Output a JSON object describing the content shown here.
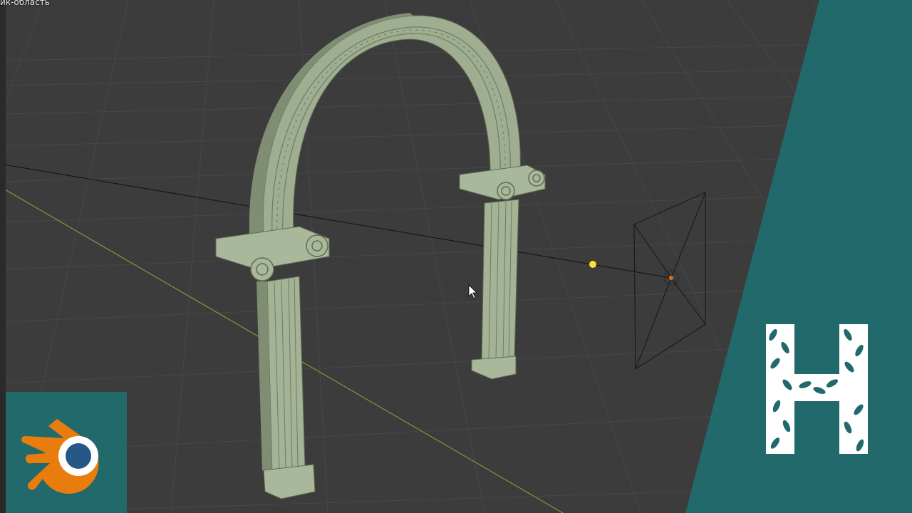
{
  "viewport": {
    "header_label": "ик-область"
  },
  "colors": {
    "viewport_bg": "#3c3c3c",
    "grid_line": "#474747",
    "axis_x": "#7a9a3a",
    "arch_stone": "#a9b89a",
    "arch_shadow": "#7f8d72",
    "teal_panel": "#22696b",
    "blender_orange": "#e87d0d",
    "blender_blue": "#265787",
    "light_yellow": "#ffe033"
  },
  "icons": {
    "blender_logo": "blender-logo-icon",
    "channel_logo": "leaf-letter-h-logo",
    "cursor": "mouse-pointer-icon",
    "light": "point-light-icon",
    "camera": "camera-frame-icon"
  }
}
